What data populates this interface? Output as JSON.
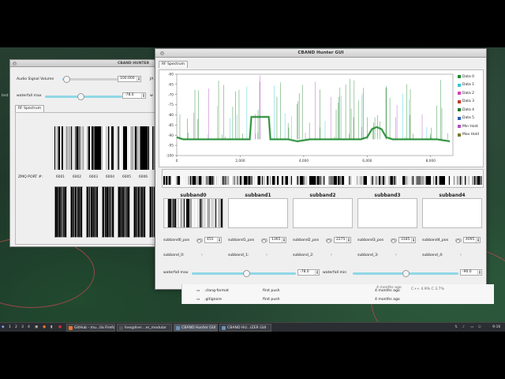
{
  "back_window": {
    "title": "CBAND HUNTER",
    "close_icon": "x",
    "audio_label": "Audio Signal Volume",
    "audio_value": "100.000",
    "audio_fraction": 0.02,
    "waterfall_max_label": "waterfall max",
    "waterfall_max_value": "-78.0",
    "waterfall_max_fraction": 0.46,
    "trunc_j": "JA",
    "trunc_w": "w",
    "trunc_inst": "Inst",
    "tab": "RF Spectrum",
    "zmq_label": "ZMQ PORT #:",
    "ports": [
      "6001",
      "6002",
      "6003",
      "6004",
      "6005",
      "6006",
      "6"
    ]
  },
  "main_window": {
    "title": "CBAND Hunter GUI",
    "tab": "RF Spectrum",
    "legend": [
      {
        "name": "Data 0",
        "color": "#1f8a2e"
      },
      {
        "name": "Data 1",
        "color": "#37c8d8"
      },
      {
        "name": "Data 2",
        "color": "#d63fb8"
      },
      {
        "name": "Data 3",
        "color": "#c03a2b"
      },
      {
        "name": "Data 4",
        "color": "#1f7a2a"
      },
      {
        "name": "Data 5",
        "color": "#2a5fb8"
      },
      {
        "name": "Min Hold",
        "color": "#b04fc2"
      },
      {
        "name": "Max Hold",
        "color": "#7a7a2a"
      }
    ],
    "y_ticks": [
      "-60",
      "-65",
      "-70",
      "-75",
      "-80",
      "-85",
      "-90",
      "-95",
      "-100"
    ],
    "x_ticks": [
      "0",
      "2,000",
      "4,000",
      "6,000",
      "8,000"
    ],
    "subbands": [
      {
        "title": "subband0",
        "pos_label": "subband0_pos",
        "pos_value": "455",
        "freq_label": "subband_0:"
      },
      {
        "title": "subband1",
        "pos_label": "subband1_pos",
        "pos_value": "1365",
        "freq_label": "subband_1:"
      },
      {
        "title": "subband2",
        "pos_label": "subband2_pos",
        "pos_value": "2275",
        "freq_label": "subband_2:"
      },
      {
        "title": "subband3",
        "pos_label": "subband3_pos",
        "pos_value": "3185",
        "freq_label": "subband_3:"
      },
      {
        "title": "subband4",
        "pos_label": "subband4_pos",
        "pos_value": "4095",
        "freq_label": "subband_4:"
      }
    ],
    "waterfall_max_label": "waterfall max",
    "waterfall_max_value": "-78.0",
    "waterfall_max_fraction": 0.52,
    "waterfall_min_label": "waterfall min",
    "waterfall_min_value": "-90.0",
    "waterfall_min_fraction": 0.5,
    "chart_data": {
      "type": "line",
      "x_range": [
        0,
        8700
      ],
      "ylim": [
        -100,
        -60
      ],
      "series": [
        {
          "name": "Data 0",
          "x": [
            0,
            200,
            500,
            800,
            1000,
            1400,
            1800,
            2200,
            2300,
            2350,
            2800,
            2900,
            2950,
            3500,
            3800,
            4200,
            4600,
            5200,
            5800,
            6000,
            6150,
            6300,
            6450,
            6600,
            6800,
            7400,
            8200,
            8600
          ],
          "y": [
            -91,
            -92,
            -92,
            -92,
            -92,
            -92,
            -92,
            -92,
            -92,
            -81,
            -81,
            -81,
            -92,
            -92,
            -93,
            -92,
            -92,
            -92,
            -92,
            -91,
            -87,
            -86,
            -87,
            -91,
            -92,
            -92,
            -92,
            -93
          ]
        }
      ]
    }
  },
  "browser": {
    "rows": [
      {
        "name": ".clang-format",
        "msg": "first push",
        "time": "4 months ago"
      },
      {
        "name": ".gitignore",
        "msg": "first push",
        "time": "4 months ago"
      }
    ],
    "time_top": "4 months ago",
    "stats": "C++ 4.9%   C 3.7%"
  },
  "taskbar": {
    "workspaces": [
      "1",
      "2",
      "3",
      "4"
    ],
    "tasks": [
      {
        "label": "GitHub - mu...lla Firefox",
        "icon": "firefox-icon",
        "color": "#e8772e"
      },
      {
        "label": "live@live:...er_modular",
        "icon": "terminal-icon",
        "color": "#555555"
      },
      {
        "label": "CBAND Hunter GUI",
        "icon": "app-icon",
        "color": "#6a8fb8"
      },
      {
        "label": "CBAND HU...IZER GUI",
        "icon": "app-icon",
        "color": "#6a8fb8"
      }
    ],
    "clock": "9:16"
  }
}
